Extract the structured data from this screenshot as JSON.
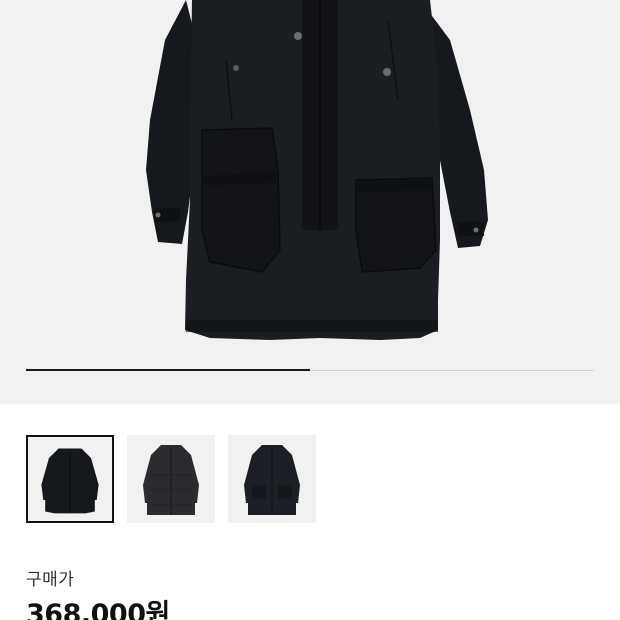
{
  "product": {
    "image_name": "black-hooded-coat-photo",
    "carousel_progress": 0.5
  },
  "thumbnails": [
    {
      "name": "coat-thumbnail-front",
      "selected": true
    },
    {
      "name": "coat-thumbnail-quilted",
      "selected": false
    },
    {
      "name": "coat-thumbnail-alt",
      "selected": false
    }
  ],
  "price": {
    "label": "구매가",
    "value": "368,000원"
  },
  "colors": {
    "background": "#f1f1f1",
    "coat": "#15181d",
    "progress_active": "#1a1a1a",
    "progress_track": "#cfcfcf",
    "thumb_selected_border": "#111111"
  }
}
